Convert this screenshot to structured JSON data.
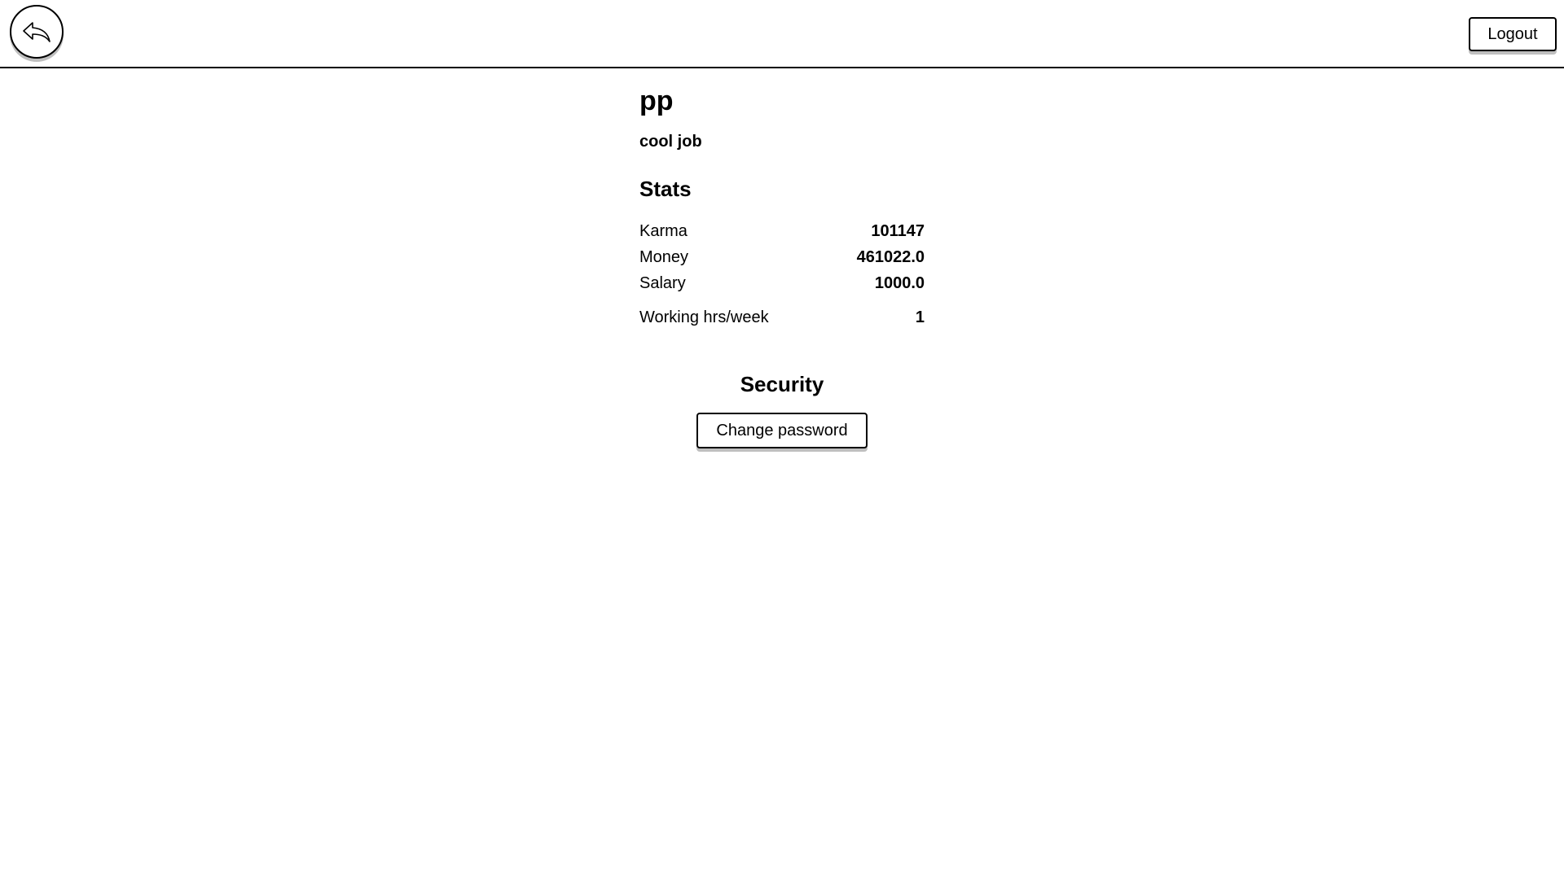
{
  "header": {
    "back_icon": "reply-arrow-icon",
    "logout_label": "Logout"
  },
  "profile": {
    "username": "pp",
    "job": "cool job"
  },
  "stats": {
    "heading": "Stats",
    "rows": [
      {
        "label": "Karma",
        "value": "101147"
      },
      {
        "label": "Money",
        "value": "461022.0"
      },
      {
        "label": "Salary",
        "value": "1000.0"
      },
      {
        "label": "Working hrs/week",
        "value": "1"
      }
    ]
  },
  "security": {
    "heading": "Security",
    "change_password_label": "Change password"
  },
  "colors": {
    "background": "#ffffff",
    "text": "#000000",
    "border": "#000000"
  }
}
